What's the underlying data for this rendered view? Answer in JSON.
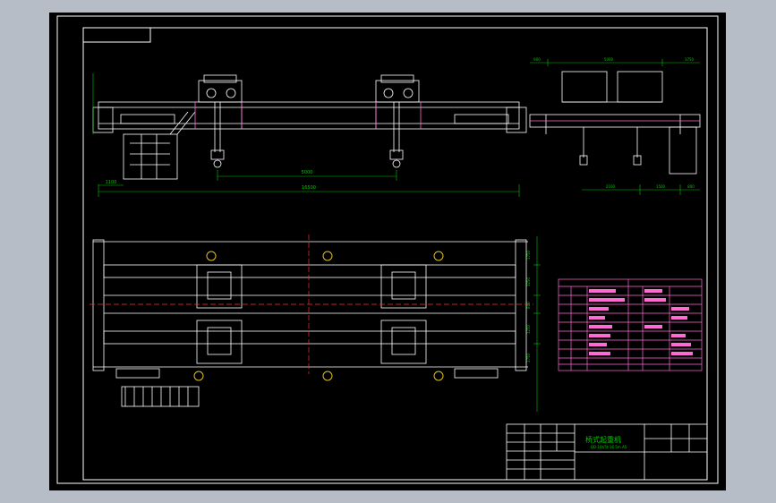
{
  "app": {
    "background_color": "#b6bdc7",
    "canvas_color": "#000000",
    "line_color": "#ffffff",
    "dimension_color": "#00c800",
    "part_color": "#ff6ad5",
    "centerline_color": "#ff3030"
  },
  "drawing": {
    "dimensions": {
      "span": "16500",
      "hook_spacing": "5000",
      "left_offset": "1100",
      "side_trolley_gauge": "5000",
      "side_left": "900",
      "side_right": "1750",
      "side_bottom_left": "2100",
      "side_bottom_mid": "1500",
      "side_bottom_right": "800",
      "plan_1": "1750",
      "plan_2": "1250",
      "plan_3": "800",
      "plan_4": "1250",
      "plan_5": "1750"
    },
    "title_block": {
      "title": "桥式起重机",
      "subtitle": "QD-10t/5t-16.5m A5"
    }
  }
}
